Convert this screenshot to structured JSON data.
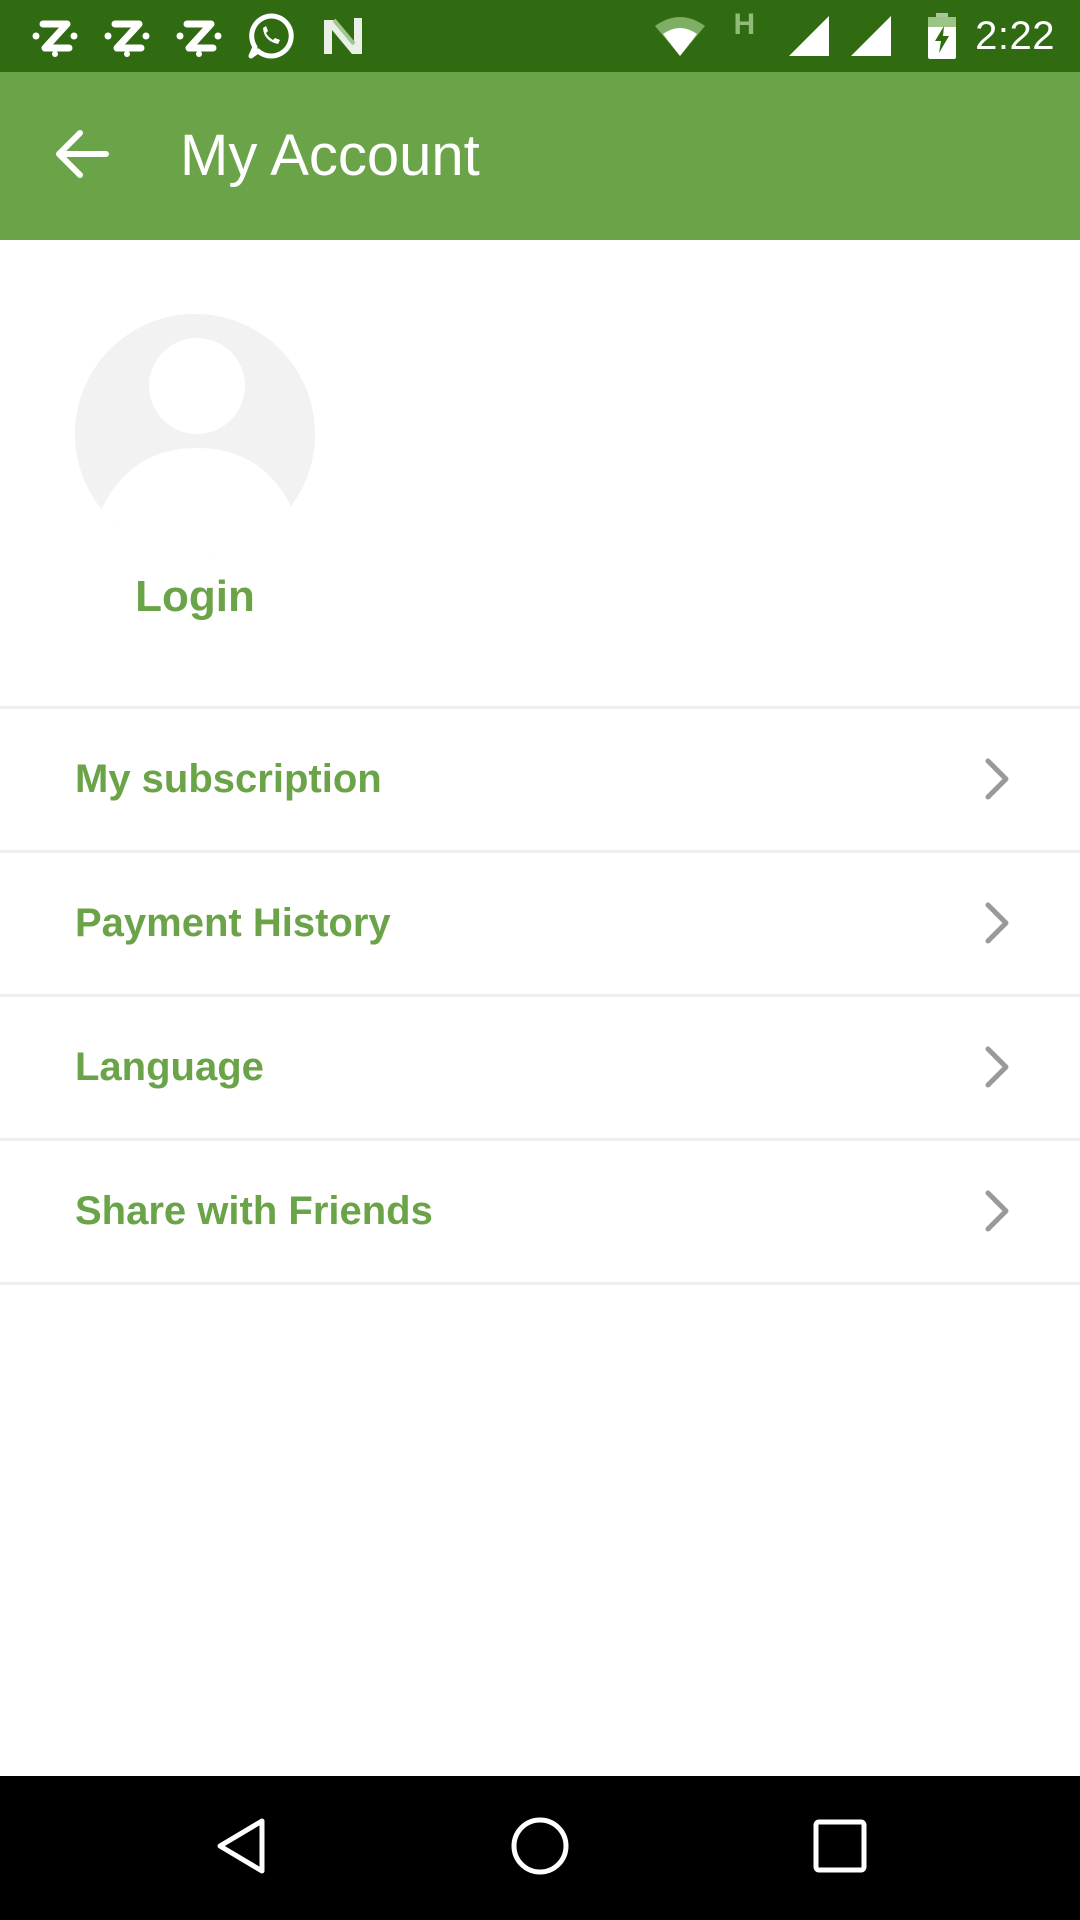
{
  "status_bar": {
    "time": "2:22",
    "network_label": "H",
    "notification_icons": [
      "zedge-icon",
      "zedge-icon",
      "zedge-icon",
      "whatsapp-icon",
      "n-app-icon"
    ],
    "system_icons": [
      "wifi-icon",
      "cell-signal-icon",
      "cell-signal-icon",
      "battery-charging-icon"
    ]
  },
  "app_bar": {
    "title": "My Account",
    "back_icon": "arrow-back-icon"
  },
  "profile": {
    "avatar_icon": "default-avatar-icon",
    "login_label": "Login"
  },
  "menu": {
    "items": [
      {
        "label": "My subscription"
      },
      {
        "label": "Payment History"
      },
      {
        "label": "Language"
      },
      {
        "label": "Share with Friends"
      }
    ],
    "chevron_icon": "chevron-right-icon"
  },
  "nav_bar": {
    "buttons": [
      "back-triangle-icon",
      "home-circle-icon",
      "recents-square-icon"
    ]
  },
  "colors": {
    "status_bar": "#306b12",
    "app_bar": "#6ba348",
    "accent_text": "#6ba348",
    "divider": "#eeeeee",
    "chevron": "#999999",
    "avatar_bg": "#f2f2f2"
  }
}
